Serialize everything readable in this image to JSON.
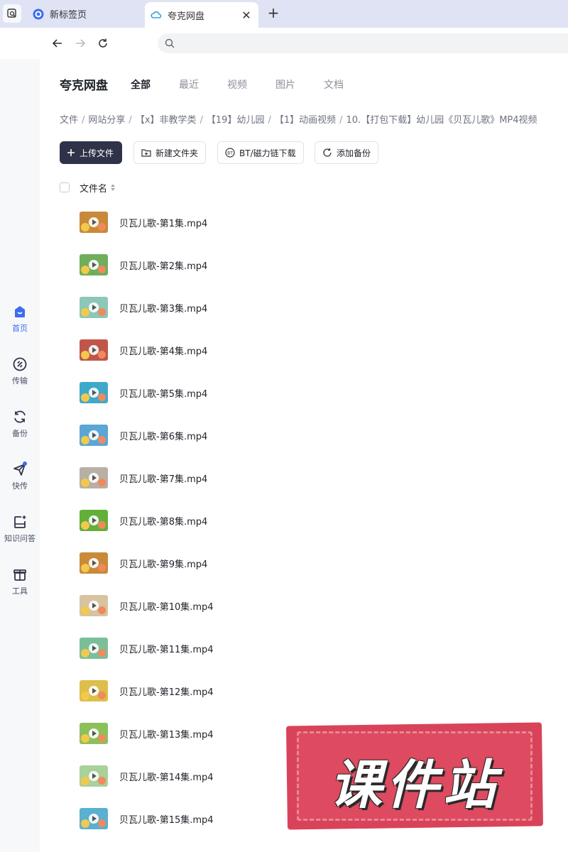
{
  "browser": {
    "tabs": [
      {
        "label": "新标签页",
        "active": false
      },
      {
        "label": "夸克网盘",
        "active": true
      }
    ]
  },
  "sidebar": {
    "items": [
      {
        "label": "首页",
        "icon": "home-icon",
        "active": true
      },
      {
        "label": "传输",
        "icon": "transfer-icon",
        "active": false
      },
      {
        "label": "备份",
        "icon": "backup-icon",
        "active": false
      },
      {
        "label": "快传",
        "icon": "send-icon",
        "active": false
      },
      {
        "label": "知识问答",
        "icon": "knowledge-icon",
        "active": false
      },
      {
        "label": "工具",
        "icon": "toolbox-icon",
        "active": false
      }
    ]
  },
  "header": {
    "title": "夸克网盘",
    "tabs": [
      "全部",
      "最近",
      "视频",
      "图片",
      "文档"
    ]
  },
  "breadcrumb": [
    "文件",
    "网站分享",
    "【x】非教学类",
    "【19】幼儿园",
    "【1】动画视频",
    "10.【打包下载】幼儿园《贝瓦儿歌》MP4视频"
  ],
  "actions": {
    "upload": "上传文件",
    "new_folder": "新建文件夹",
    "bt_download": "BT/磁力链下载",
    "add_backup": "添加备份"
  },
  "list": {
    "column_name": "文件名",
    "files": [
      {
        "name": "贝瓦儿歌-第1集.mp4",
        "thumb": "#c9893a"
      },
      {
        "name": "贝瓦儿歌-第2集.mp4",
        "thumb": "#6fae5a"
      },
      {
        "name": "贝瓦儿歌-第3集.mp4",
        "thumb": "#8cc7b8"
      },
      {
        "name": "贝瓦儿歌-第4集.mp4",
        "thumb": "#c0564a"
      },
      {
        "name": "贝瓦儿歌-第5集.mp4",
        "thumb": "#3fa9c9"
      },
      {
        "name": "贝瓦儿歌-第6集.mp4",
        "thumb": "#5aa6d6"
      },
      {
        "name": "贝瓦儿歌-第7集.mp4",
        "thumb": "#b8b0a4"
      },
      {
        "name": "贝瓦儿歌-第8集.mp4",
        "thumb": "#62b03a"
      },
      {
        "name": "贝瓦儿歌-第9集.mp4",
        "thumb": "#c98a3a"
      },
      {
        "name": "贝瓦儿歌-第10集.mp4",
        "thumb": "#d7c3a0"
      },
      {
        "name": "贝瓦儿歌-第11集.mp4",
        "thumb": "#7bbf9a"
      },
      {
        "name": "贝瓦儿歌-第12集.mp4",
        "thumb": "#dcbf4a"
      },
      {
        "name": "贝瓦儿歌-第13集.mp4",
        "thumb": "#8bc05a"
      },
      {
        "name": "贝瓦儿歌-第14集.mp4",
        "thumb": "#a9d19a"
      },
      {
        "name": "贝瓦儿歌-第15集.mp4",
        "thumb": "#5ab0d0"
      }
    ]
  },
  "watermark": {
    "text": "课件站",
    "color": "#de4a5f"
  },
  "colors": {
    "accent": "#3c6cf0",
    "primary_button": "#2f3349"
  }
}
